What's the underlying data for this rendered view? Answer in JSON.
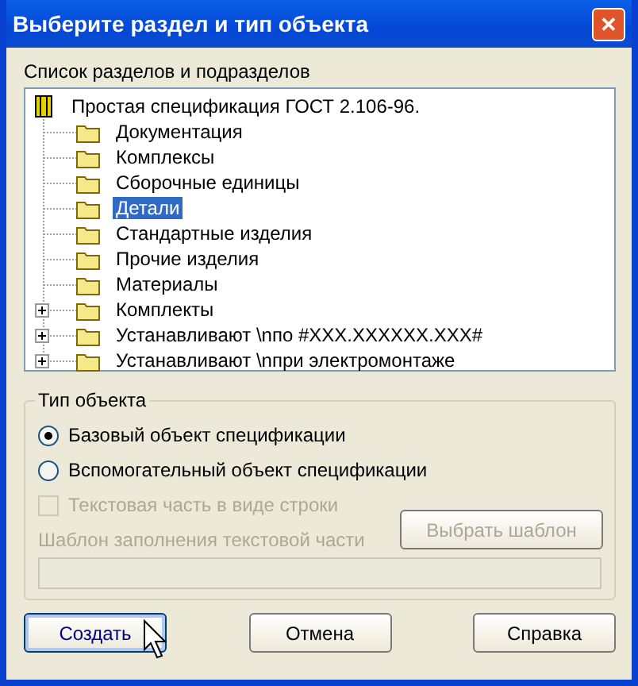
{
  "window": {
    "title": "Выберите раздел и тип объекта",
    "close_glyph": "✕"
  },
  "sections": {
    "label": "Список разделов и подразделов",
    "tree": [
      {
        "label": "Простая спецификация ГОСТ 2.106-96.",
        "selected": false,
        "children": [
          {
            "label": "Документация",
            "selected": false,
            "has_children": false
          },
          {
            "label": "Комплексы",
            "selected": false,
            "has_children": false
          },
          {
            "label": "Сборочные единицы",
            "selected": false,
            "has_children": false
          },
          {
            "label": "Детали",
            "selected": true,
            "has_children": false
          },
          {
            "label": "Стандартные изделия",
            "selected": false,
            "has_children": false
          },
          {
            "label": "Прочие изделия",
            "selected": false,
            "has_children": false
          },
          {
            "label": "Материалы",
            "selected": false,
            "has_children": false
          },
          {
            "label": "Комплекты",
            "selected": false,
            "has_children": true
          },
          {
            "label": "Устанавливают \\nпо #XXX.XXXXXX.XXX#",
            "selected": false,
            "has_children": true
          },
          {
            "label": "Устанавливают \\nпри электромонтаже",
            "selected": false,
            "has_children": true
          }
        ]
      }
    ]
  },
  "object_type": {
    "legend": "Тип объекта",
    "options": [
      {
        "label": "Базовый объект спецификации",
        "selected": true
      },
      {
        "label": "Вспомогательный объект спецификации",
        "selected": false
      }
    ],
    "text_row": {
      "label": "Текстовая часть в виде строки",
      "checked": false,
      "disabled": true
    },
    "template_label": "Шаблон заполнения текстовой части",
    "template_disabled": true,
    "choose_button": {
      "label": "Выбрать шаблон",
      "disabled": true
    }
  },
  "buttons": [
    {
      "label": "Создать",
      "focused": true
    },
    {
      "label": "Отмена",
      "focused": false
    },
    {
      "label": "Справка",
      "focused": false
    }
  ]
}
